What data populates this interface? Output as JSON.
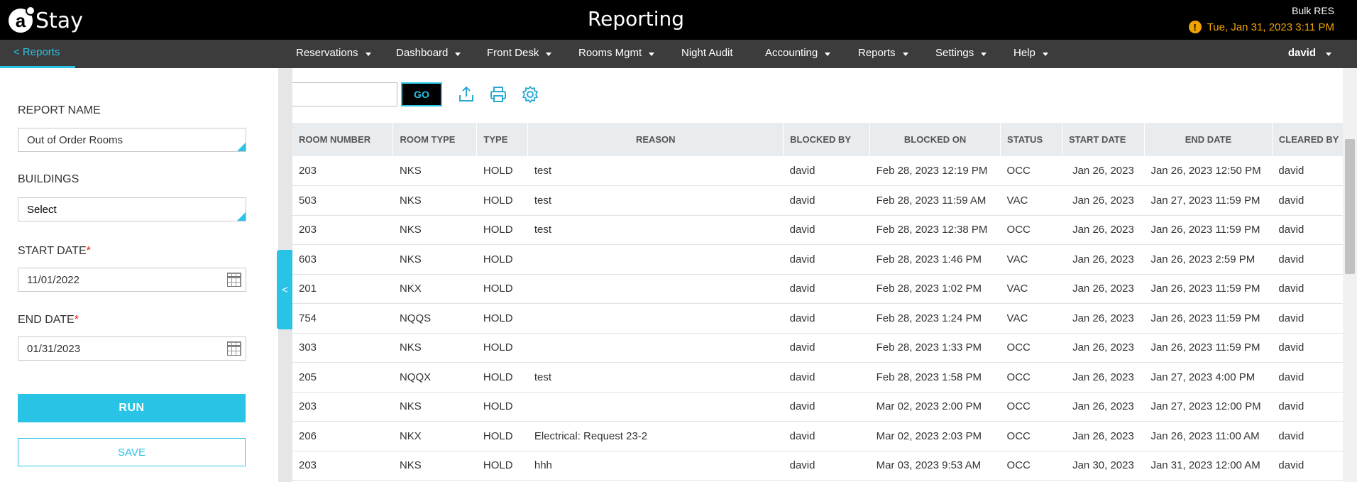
{
  "header": {
    "logo_text": "Stay",
    "logo_mark": "a",
    "title": "Reporting",
    "property": "Bulk RES",
    "datetime": "Tue, Jan 31, 2023 3:11 PM",
    "warning_glyph": "!"
  },
  "nav": {
    "back_label": "< Reports",
    "items": [
      {
        "label": "Reservations",
        "dropdown": true
      },
      {
        "label": "Dashboard",
        "dropdown": true
      },
      {
        "label": "Front Desk",
        "dropdown": true
      },
      {
        "label": "Rooms Mgmt",
        "dropdown": true
      },
      {
        "label": "Night Audit",
        "dropdown": false
      },
      {
        "label": "Accounting",
        "dropdown": true
      },
      {
        "label": "Reports",
        "dropdown": true
      },
      {
        "label": "Settings",
        "dropdown": true
      },
      {
        "label": "Help",
        "dropdown": true
      }
    ],
    "user": "david"
  },
  "form": {
    "report_name_label": "REPORT NAME",
    "report_name_value": "Out of Order Rooms",
    "buildings_label": "BUILDINGS",
    "buildings_value": "Select",
    "start_date_label": "START DATE",
    "start_date_value": "11/01/2022",
    "end_date_label": "END DATE",
    "end_date_value": "01/31/2023",
    "required_mark": "*",
    "run_label": "RUN",
    "save_label": "SAVE",
    "collapse_glyph": "<"
  },
  "toolbar": {
    "search_value": "",
    "go_label": "GO"
  },
  "colors": {
    "accent": "#29c3e6",
    "warning": "#f0a300",
    "nav_bg": "#3c3c3c",
    "header_bg": "#000000"
  },
  "table": {
    "columns": [
      "ROOM NUMBER",
      "ROOM TYPE",
      "TYPE",
      "REASON",
      "BLOCKED BY",
      "BLOCKED ON",
      "STATUS",
      "START DATE",
      "END DATE",
      "CLEARED BY"
    ],
    "rows": [
      [
        "203",
        "NKS",
        "HOLD",
        "test",
        "david",
        "Feb 28, 2023 12:19 PM",
        "OCC",
        "Jan 26, 2023",
        "Jan 26, 2023 12:50 PM",
        "david"
      ],
      [
        "503",
        "NKS",
        "HOLD",
        "test",
        "david",
        "Feb 28, 2023 11:59 AM",
        "VAC",
        "Jan 26, 2023",
        "Jan 27, 2023 11:59 PM",
        "david"
      ],
      [
        "203",
        "NKS",
        "HOLD",
        "test",
        "david",
        "Feb 28, 2023 12:38 PM",
        "OCC",
        "Jan 26, 2023",
        "Jan 26, 2023 11:59 PM",
        "david"
      ],
      [
        "603",
        "NKS",
        "HOLD",
        "",
        "david",
        "Feb 28, 2023 1:46 PM",
        "VAC",
        "Jan 26, 2023",
        "Jan 26, 2023 2:59 PM",
        "david"
      ],
      [
        "201",
        "NKX",
        "HOLD",
        "",
        "david",
        "Feb 28, 2023 1:02 PM",
        "VAC",
        "Jan 26, 2023",
        "Jan 26, 2023 11:59 PM",
        "david"
      ],
      [
        "754",
        "NQQS",
        "HOLD",
        "",
        "david",
        "Feb 28, 2023 1:24 PM",
        "VAC",
        "Jan 26, 2023",
        "Jan 26, 2023 11:59 PM",
        "david"
      ],
      [
        "303",
        "NKS",
        "HOLD",
        "",
        "david",
        "Feb 28, 2023 1:33 PM",
        "OCC",
        "Jan 26, 2023",
        "Jan 26, 2023 11:59 PM",
        "david"
      ],
      [
        "205",
        "NQQX",
        "HOLD",
        "test",
        "david",
        "Feb 28, 2023 1:58 PM",
        "OCC",
        "Jan 26, 2023",
        "Jan 27, 2023 4:00 PM",
        "david"
      ],
      [
        "203",
        "NKS",
        "HOLD",
        "",
        "david",
        "Mar 02, 2023 2:00 PM",
        "OCC",
        "Jan 26, 2023",
        "Jan 27, 2023 12:00 PM",
        "david"
      ],
      [
        "206",
        "NKX",
        "HOLD",
        "Electrical: Request 23-2",
        "david",
        "Mar 02, 2023 2:03 PM",
        "OCC",
        "Jan 26, 2023",
        "Jan 26, 2023 11:00 AM",
        "david"
      ],
      [
        "203",
        "NKS",
        "HOLD",
        "hhh",
        "david",
        "Mar 03, 2023 9:53 AM",
        "OCC",
        "Jan 30, 2023",
        "Jan 31, 2023 12:00 AM",
        "david"
      ]
    ]
  }
}
